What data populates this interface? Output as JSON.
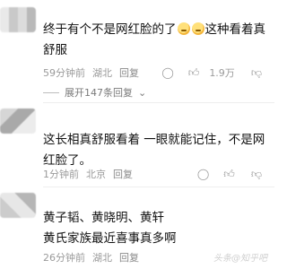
{
  "comments": [
    {
      "text_before_emoji": "终于有个不是网红脸的了",
      "text_after_emoji": "这种看着真舒服",
      "emoji_count": 2,
      "time": "59分钟前",
      "location": "湖北",
      "reply_label": "回复",
      "likes": "1.9万",
      "expand_replies": "展开147条回复"
    },
    {
      "text": "这长相真舒服看着 一眼就能记住，不是网红脸了。",
      "time": "1分钟前",
      "location": "北京",
      "reply_label": "回复",
      "likes": ""
    },
    {
      "line1": "黄子韬、黄晓明、黄轩",
      "line2": "黄氏家族最近喜事真多啊",
      "time": "26分钟前",
      "location": "湖北",
      "reply_label": "回复",
      "likes": ""
    }
  ],
  "watermark": "头条@知乎吧"
}
